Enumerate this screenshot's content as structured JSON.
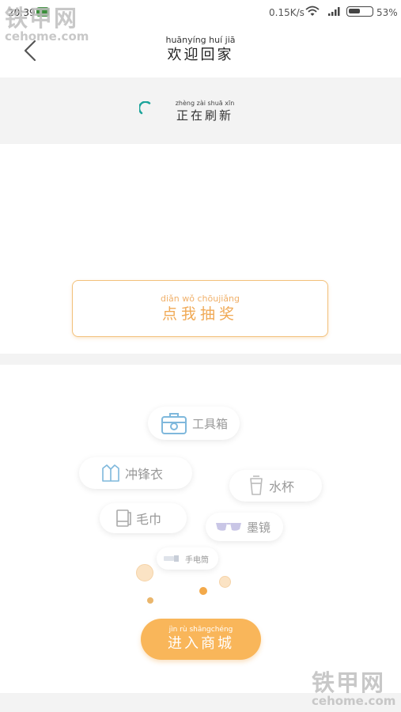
{
  "status_bar": {
    "time": "20:39",
    "net_speed": "0.15K/s",
    "battery_percent": "53%",
    "battery_level": 0.53,
    "icons": [
      "network-indicator-icon",
      "wifi-icon",
      "signal-icon",
      "battery-icon"
    ]
  },
  "watermark": {
    "title": "铁甲网",
    "domain": "cehome.com"
  },
  "header": {
    "back_icon": "chevron-left-icon",
    "title_pinyin": "huānyíng huí  jiā",
    "title": "欢迎回家"
  },
  "refresh": {
    "pinyin": "zhèng zài shuā xīn",
    "text": "正在刷新",
    "spinner_color": "#1aa39a"
  },
  "lottery_button": {
    "pinyin": "diǎn wǒ chōujiǎng",
    "label": "点我抽奖",
    "color": "#f0a955"
  },
  "prizes": [
    {
      "label": "工具箱",
      "icon": "toolbox-icon"
    },
    {
      "label": "冲锋衣",
      "icon": "jacket-icon"
    },
    {
      "label": "水杯",
      "icon": "cup-icon"
    },
    {
      "label": "毛巾",
      "icon": "towel-icon"
    },
    {
      "label": "墨镜",
      "icon": "sunglasses-icon"
    },
    {
      "label": "手电筒",
      "icon": "flashlight-icon"
    }
  ],
  "mall_button": {
    "pinyin": "jìn   rù  shāngchéng",
    "label": "进入商城",
    "color": "#f9b65a"
  }
}
